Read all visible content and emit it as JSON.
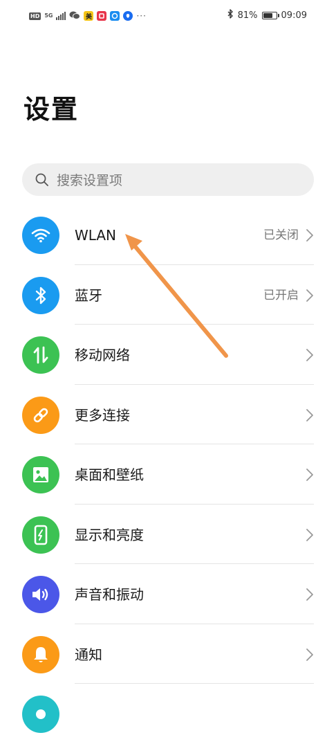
{
  "status_bar": {
    "left_icons": [
      "hd-icon",
      "5g-icon",
      "signal-icon",
      "wechat-icon",
      "meituan-icon",
      "red-app-icon",
      "blue-app-icon",
      "blue-circle-app-icon",
      "more-dots-icon"
    ],
    "hd_label": "HD",
    "network_label": "5G",
    "meituan_label": "美",
    "dots": "···",
    "battery_percent": "81%",
    "battery_level": 0.81,
    "time": "09:09"
  },
  "page": {
    "title": "设置"
  },
  "search": {
    "placeholder": "搜索设置项"
  },
  "settings": [
    {
      "label": "WLAN",
      "status": "已关闭",
      "icon": "wifi-icon",
      "color": "#1a9bf0"
    },
    {
      "label": "蓝牙",
      "status": "已开启",
      "icon": "bluetooth-icon",
      "color": "#1a9bf0"
    },
    {
      "label": "移动网络",
      "status": "",
      "icon": "mobile-data-icon",
      "color": "#3cc253"
    },
    {
      "label": "更多连接",
      "status": "",
      "icon": "link-icon",
      "color": "#fb9a17"
    },
    {
      "label": "桌面和壁纸",
      "status": "",
      "icon": "image-icon",
      "color": "#3cc253"
    },
    {
      "label": "显示和亮度",
      "status": "",
      "icon": "phone-brightness-icon",
      "color": "#3cc253"
    },
    {
      "label": "声音和振动",
      "status": "",
      "icon": "speaker-icon",
      "color": "#4b57e8"
    },
    {
      "label": "通知",
      "status": "",
      "icon": "bell-icon",
      "color": "#fb9a17"
    },
    {
      "label": "",
      "status": "",
      "icon": "partial-icon",
      "color": "#22c0c8"
    }
  ],
  "annotation": {
    "color": "#f0954a"
  }
}
